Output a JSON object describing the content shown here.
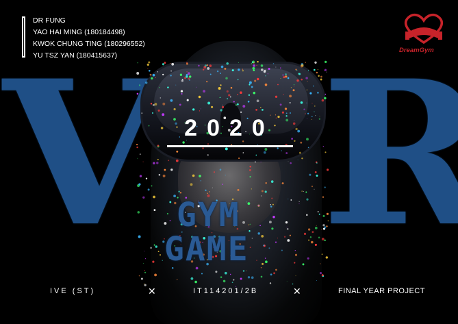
{
  "credits": [
    "DR FUNG",
    "YAO HAI MING (180184498)",
    "KWOK CHUNG TING (180296552)",
    "YU TSZ YAN (180415637)"
  ],
  "logo": {
    "word_a": "Dream",
    "word_b": "Gym",
    "color": "#c7232a"
  },
  "big_letters": {
    "left": "V",
    "right": "R"
  },
  "year": "2020",
  "game_title": {
    "line1": "GYM",
    "line2": "GAME"
  },
  "footer": {
    "left": "IVE (ST)",
    "sep1": "✕",
    "middle": "IT114201/2B",
    "sep2": "✕",
    "right": "FINAL YEAR PROJECT"
  },
  "colors": {
    "background": "#000000",
    "accent_blue": "#1f4f86",
    "text": "#ffffff"
  }
}
